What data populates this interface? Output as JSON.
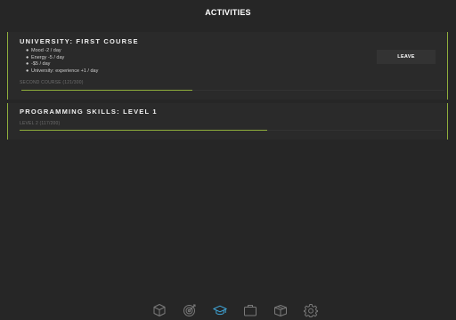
{
  "header": {
    "title": "ACTIVITIES"
  },
  "activities": [
    {
      "title": "UNIVERSITY: FIRST COURSE",
      "effects": [
        "Mood -2 / day",
        "Energy -5 / day",
        "-$5 / day",
        "University: experience +1 / day"
      ],
      "action_label": "LEAVE",
      "progress": {
        "label": "SECOND COURSE (121/300)",
        "current": 121,
        "total": 300
      }
    },
    {
      "title": "PROGRAMMING SKILLS: LEVEL 1",
      "progress": {
        "label": "LEVEL 2 (117/200)",
        "current": 117,
        "total": 200
      }
    }
  ],
  "tabbar": {
    "tabs": [
      {
        "icon": "cube-icon",
        "active": false
      },
      {
        "icon": "target-icon",
        "active": false
      },
      {
        "icon": "graduation-cap-icon",
        "active": true
      },
      {
        "icon": "briefcase-icon",
        "active": false
      },
      {
        "icon": "package-icon",
        "active": false
      },
      {
        "icon": "gear-icon",
        "active": false
      }
    ]
  },
  "colors": {
    "background": "#262626",
    "card": "#2a2a2a",
    "accent": "#8fae3c",
    "active_tab": "#3fa4d6",
    "inactive_tab": "#7a7a7a"
  }
}
